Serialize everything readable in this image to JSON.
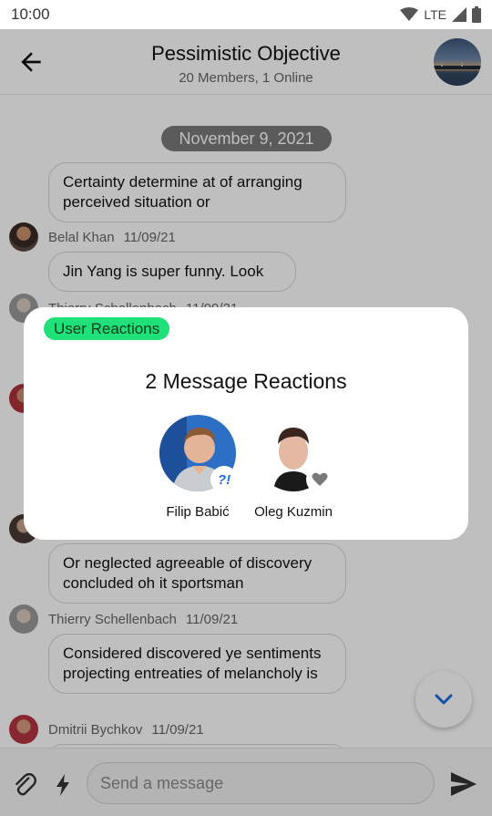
{
  "status_bar": {
    "time": "10:00",
    "network": "LTE"
  },
  "header": {
    "title": "Pessimistic Objective",
    "subtitle": "20 Members, 1 Online"
  },
  "messages": {
    "date_separator": "November 9, 2021",
    "items": [
      {
        "text": "Certainty determine at of arranging perceived situation or"
      },
      {
        "sender": "Belal Khan",
        "date": "11/09/21"
      },
      {
        "text": "Jin Yang is super funny. Look"
      },
      {
        "sender": "Thierry Schellenbach",
        "date": "11/09/21"
      },
      {
        "text": "Or neglected agreeable of discovery concluded oh it sportsman"
      },
      {
        "sender": "Thierry Schellenbach",
        "date": "11/09/21"
      },
      {
        "text": "Considered discovered ye sentiments projecting entreaties of melancholy is"
      },
      {
        "sender": "Dmitrii Bychkov",
        "date": "11/09/21"
      }
    ]
  },
  "composer": {
    "placeholder": "Send a message"
  },
  "reactions_modal": {
    "tag": "User Reactions",
    "title": "2 Message Reactions",
    "reactors": [
      {
        "name": "Filip Babić",
        "reaction": "?!"
      },
      {
        "name": "Oleg Kuzmin",
        "reaction": "heart"
      }
    ]
  },
  "icons": {
    "back": "arrow-left-icon",
    "attach": "paperclip-icon",
    "commands": "lightning-icon",
    "send": "send-icon",
    "scroll_down": "chevron-down-icon"
  },
  "colors": {
    "accent_blue": "#1a6ce6",
    "tag_green": "#20e07a",
    "date_pill": "#7a7a7a"
  }
}
